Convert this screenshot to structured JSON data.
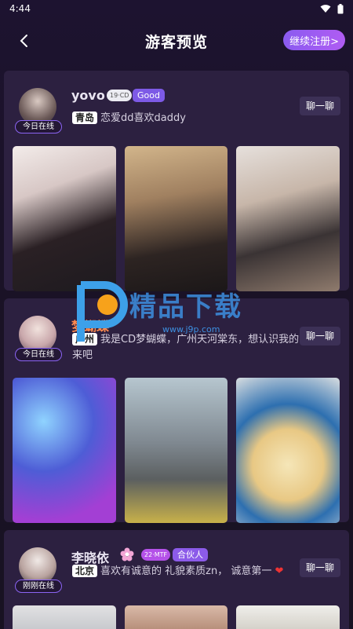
{
  "status_bar": {
    "time": "4:44"
  },
  "header": {
    "title": "游客预览",
    "register_label": "继续注册>"
  },
  "posts": [
    {
      "username": "yovo",
      "age_tag": "19·CD",
      "badge": "Good",
      "online": "今日在线",
      "city": "青岛",
      "bio": "恋爱dd喜欢daddy",
      "chat_label": "聊一聊"
    },
    {
      "username": "梦蝴蝶",
      "online": "今日在线",
      "city": "广州",
      "bio": "我是CD梦蝴蝶，广州天河棠东，想认识我的来吧",
      "chat_label": "聊一聊"
    },
    {
      "username": "李晓依",
      "age_tag": "22·MTF",
      "badge": "合伙人",
      "online": "刚刚在线",
      "city": "北京",
      "bio": "喜欢有诚意的 礼貌素质zn， 诚意第一",
      "chat_label": "聊一聊"
    }
  ],
  "watermark": {
    "brand": "精品下载",
    "url": "www.j9p.com"
  }
}
